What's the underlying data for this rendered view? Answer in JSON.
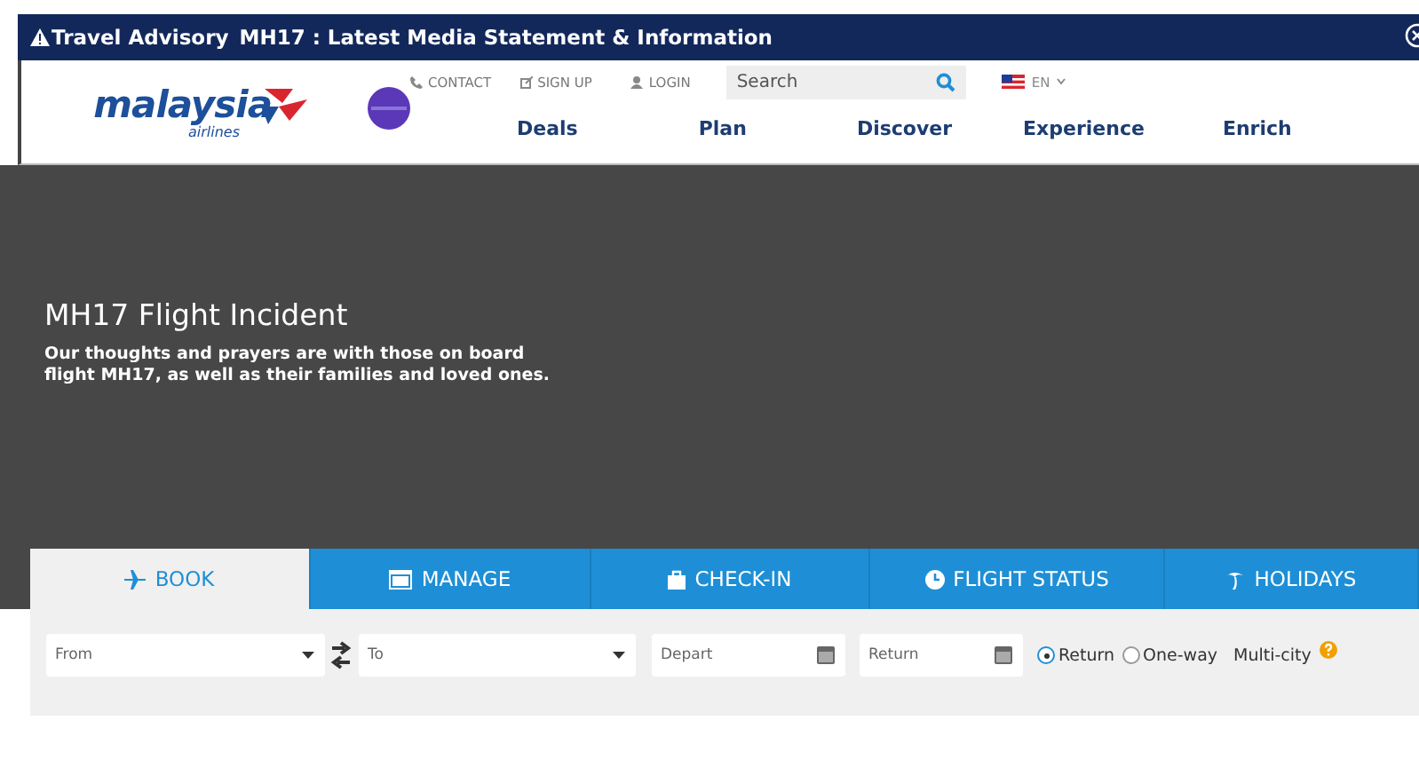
{
  "advisory": {
    "label": "Travel Advisory",
    "link": "MH17 : Latest Media Statement & Information"
  },
  "header": {
    "logo": {
      "wordmark": "malaysia",
      "subtitle": "airlines"
    },
    "utility_links": [
      {
        "label": "CONTACT"
      },
      {
        "label": "SIGN UP"
      },
      {
        "label": "LOGIN"
      }
    ],
    "search": {
      "placeholder": "Search"
    },
    "language": "EN",
    "nav": [
      "Deals",
      "Plan",
      "Discover",
      "Experience",
      "Enrich"
    ]
  },
  "hero": {
    "title": "MH17 Flight Incident",
    "text": "Our thoughts and prayers are with those on board flight MH17, as well as their families and loved ones."
  },
  "booking": {
    "tabs": [
      {
        "label": "BOOK",
        "selected": true
      },
      {
        "label": "MANAGE",
        "selected": false
      },
      {
        "label": "CHECK-IN",
        "selected": false
      },
      {
        "label": "FLIGHT STATUS",
        "selected": false
      },
      {
        "label": "HOLIDAYS",
        "selected": false
      }
    ],
    "from": {
      "placeholder": "From"
    },
    "to": {
      "placeholder": "To"
    },
    "depart": {
      "placeholder": "Depart"
    },
    "return": {
      "placeholder": "Return"
    },
    "trip_types": [
      {
        "label": "Return",
        "selected": true
      },
      {
        "label": "One-way",
        "selected": false
      }
    ],
    "multi_city": "Multi-city"
  }
}
